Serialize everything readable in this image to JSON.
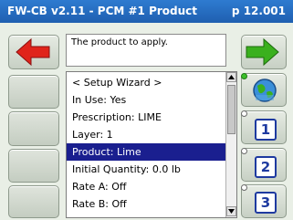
{
  "window": {
    "title": "FW-CB v2.11 - PCM #1 Product",
    "page": "p 12.001"
  },
  "info": {
    "text": "The product to apply."
  },
  "list": {
    "items": [
      {
        "label": "< Setup Wizard >",
        "selected": false
      },
      {
        "label": "In Use: Yes",
        "selected": false
      },
      {
        "label": "Prescription: LIME",
        "selected": false
      },
      {
        "label": "Layer: 1",
        "selected": false
      },
      {
        "label": "Product: Lime",
        "selected": true
      },
      {
        "label": "Initial Quantity: 0.0 lb",
        "selected": false
      },
      {
        "label": "Rate A: Off",
        "selected": false
      },
      {
        "label": "Rate B: Off",
        "selected": false
      }
    ]
  },
  "buttons": {
    "back_icon": "red-left-arrow-icon",
    "forward_icon": "green-right-arrow-icon",
    "map_icon": "globe-icon",
    "numbers": [
      "1",
      "2",
      "3"
    ]
  },
  "colors": {
    "titlebar": "#1f5fb0",
    "selection": "#1a1f8f",
    "back_arrow": "#e0241b",
    "forward_arrow": "#3ab01e",
    "number_blue": "#1e3aa0",
    "status_green": "#3bbf2a"
  }
}
